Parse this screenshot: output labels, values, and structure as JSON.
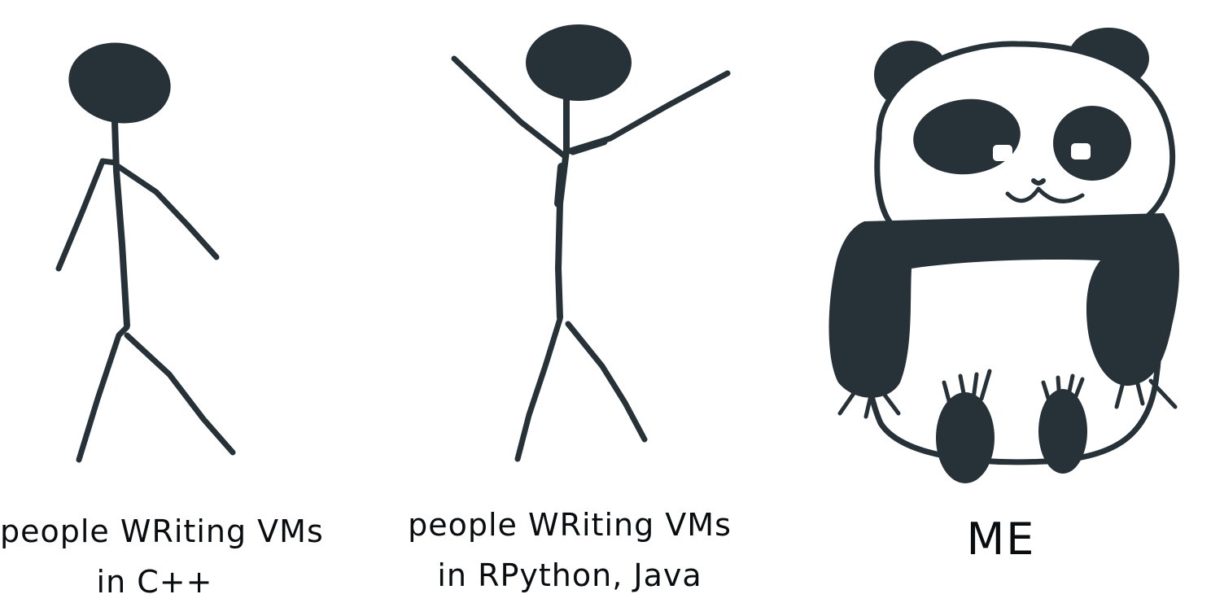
{
  "panels": [
    {
      "caption_lines": [
        "people WRiting VMs",
        "in C++"
      ]
    },
    {
      "caption_lines": [
        "people WRiting VMs",
        "in RPython, Java"
      ]
    },
    {
      "caption_lines": [
        "ME"
      ]
    }
  ],
  "colors": {
    "ink": "#263238",
    "background": "#ffffff"
  }
}
